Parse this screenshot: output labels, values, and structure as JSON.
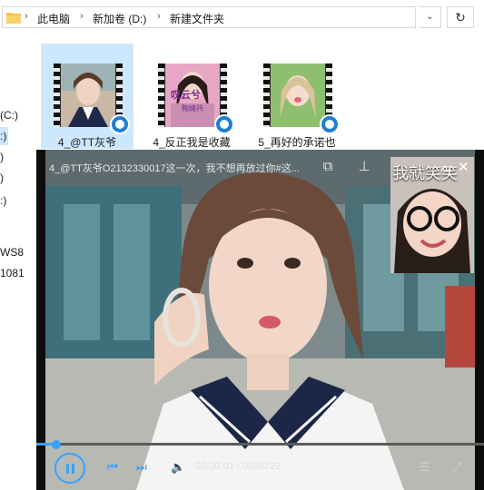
{
  "explorer": {
    "breadcrumb": [
      "此电脑",
      "新加卷 (D:)",
      "新建文件夹"
    ],
    "nav_items": [
      "(C:)",
      ":)",
      ")",
      ")",
      ":)",
      "WS8",
      "1081"
    ],
    "files": [
      {
        "name": "4_@TT灰爷",
        "selected": true
      },
      {
        "name": "4_反正我是收藏",
        "selected": false
      },
      {
        "name": "5_再好的承诺也",
        "selected": false
      }
    ],
    "thumb_texts": {
      "file2_overlay": "叹云兮",
      "file2_sub": "鞠婧祎"
    }
  },
  "player": {
    "title": "4_@TT灰爷O2132330017这一次，我不想再放过你#这...",
    "pip_caption": "我就笑笑",
    "time_current": "00:00:01",
    "time_total": "00:00:22",
    "time_display": "00:00:01 / 00:00:22",
    "progress_fraction": 0.045,
    "accent": "#3aa0ff"
  },
  "icons": {
    "title_bar": [
      "pip-icon",
      "pin-icon",
      "minimize-icon",
      "close-icon"
    ],
    "controls": [
      "play-pause-icon",
      "prev-icon",
      "next-icon",
      "volume-icon",
      "settings-icon",
      "fullscreen-icon"
    ]
  }
}
